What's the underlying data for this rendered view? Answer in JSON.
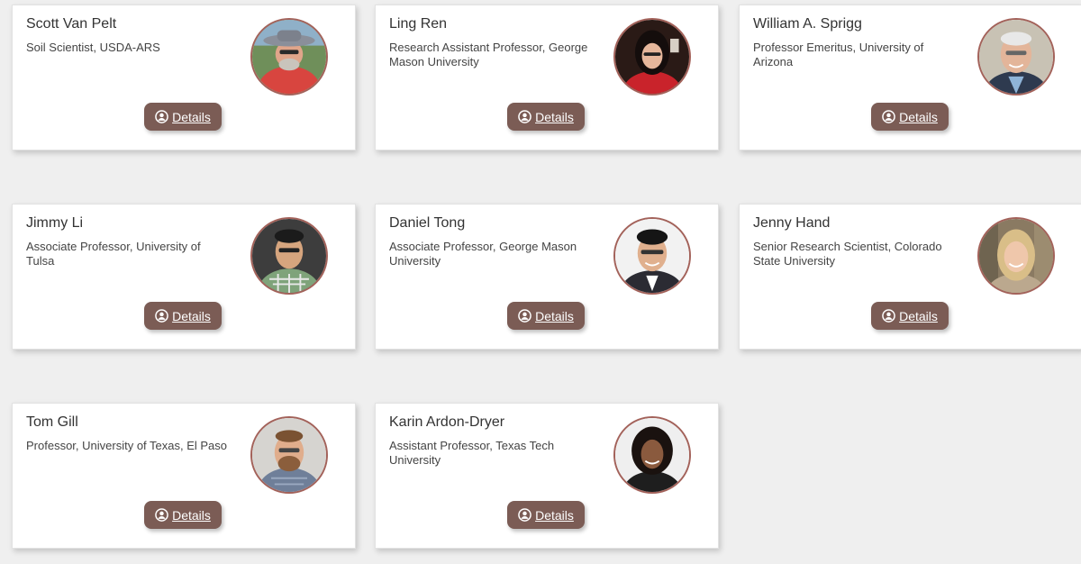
{
  "button_label": "Details",
  "people": [
    {
      "name": "Scott Van Pelt",
      "title": "Soil Scientist, USDA-ARS",
      "photo": "photo-man-hat-red-shirt"
    },
    {
      "name": "Ling Ren",
      "title": "Research Assistant Professor, George Mason University",
      "photo": "photo-woman-dark-hair"
    },
    {
      "name": "William A. Sprigg",
      "title": "Professor Emeritus, University of Arizona",
      "photo": "photo-older-man-smiling"
    },
    {
      "name": "Jimmy Li",
      "title": "Associate Professor, University of Tulsa",
      "photo": "photo-man-glasses-plaid"
    },
    {
      "name": "Daniel Tong",
      "title": "Associate Professor, George Mason University",
      "photo": "photo-man-glasses-suit"
    },
    {
      "name": "Jenny Hand",
      "title": "Senior Research Scientist, Colorado State University",
      "photo": "photo-woman-blonde"
    },
    {
      "name": "Tom Gill",
      "title": "Professor, University of Texas, El Paso",
      "photo": "photo-man-beard-glasses"
    },
    {
      "name": "Karin Ardon-Dryer",
      "title": "Assistant Professor, Texas Tech University",
      "photo": "photo-woman-curly-hair"
    }
  ],
  "colors": {
    "button_bg": "#7b5c55",
    "avatar_border": "#a3625a",
    "page_bg": "#efefef"
  },
  "icons": {
    "details": "user-circle-icon"
  }
}
